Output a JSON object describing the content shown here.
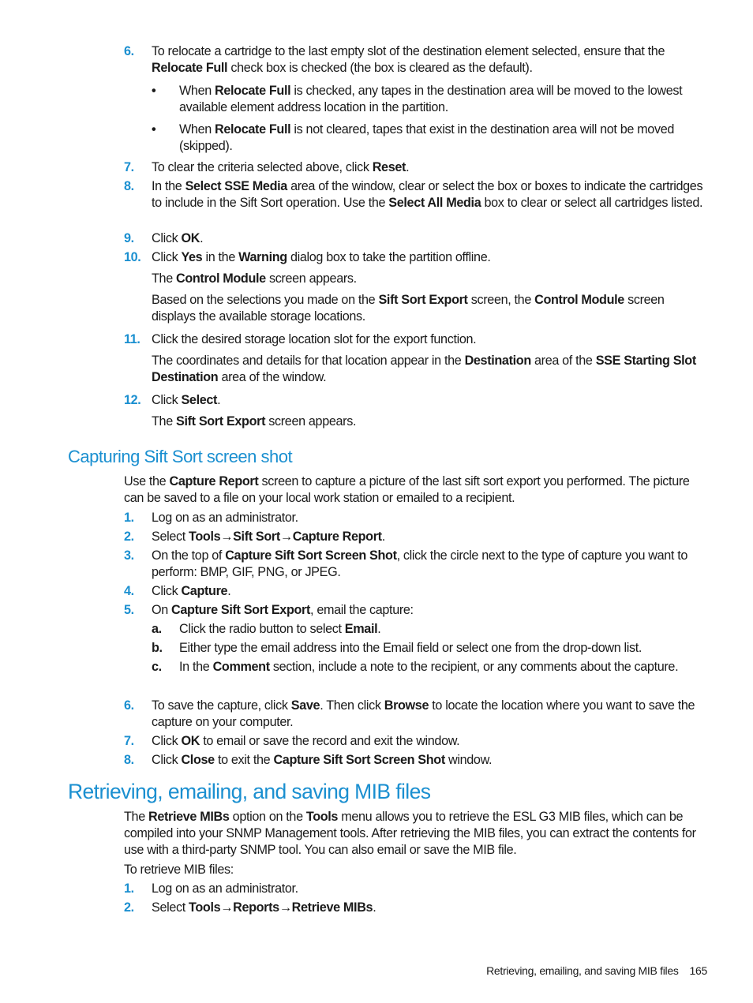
{
  "section1": {
    "step6": {
      "num": "6.",
      "t1": "To relocate a cartridge to the last empty slot of the destination element selected, ensure that the ",
      "b1": "Relocate Full",
      "t2": " check box is checked (the box is cleared as the default).",
      "bullets": [
        {
          "t1": "When ",
          "b1": "Relocate Full",
          "t2": " is checked, any tapes in the destination area will be moved to the lowest available element address location in the partition."
        },
        {
          "t1": "When ",
          "b1": "Relocate Full",
          "t2": " is not cleared, tapes that exist in the destination area will not be moved (skipped)."
        }
      ]
    },
    "step7": {
      "num": "7.",
      "t1": "To clear the criteria selected above, click ",
      "b1": "Reset",
      "t2": "."
    },
    "step8": {
      "num": "8.",
      "t1": "In the ",
      "b1": "Select SSE Media",
      "t2": " area of the window, clear or select the box or boxes to indicate the cartridges to include in the Sift Sort operation. Use the ",
      "b2": "Select All Media",
      "t3": " box to clear or select all cartridges listed."
    },
    "step9": {
      "num": "9.",
      "t1": "Click ",
      "b1": "OK",
      "t2": "."
    },
    "step10": {
      "num": "10.",
      "t1": "Click ",
      "b1": "Yes",
      "t2": " in the ",
      "b2": "Warning",
      "t3": " dialog box to take the partition offline.",
      "note1": {
        "t1": "The ",
        "b1": "Control Module",
        "t2": " screen appears."
      },
      "note2": {
        "t1": "Based on the selections you made on the ",
        "b1": "Sift Sort Export",
        "t2": " screen, the ",
        "b2": "Control Module",
        "t3": " screen displays the available storage locations."
      }
    },
    "step11": {
      "num": "11.",
      "t1": "Click the desired storage location slot for the export function.",
      "note1": {
        "t1": "The coordinates and details for that location appear in the ",
        "b1": "Destination",
        "t2": " area of the ",
        "b2": "SSE Starting Slot Destination",
        "t3": " area of the window."
      }
    },
    "step12": {
      "num": "12.",
      "t1": "Click ",
      "b1": "Select",
      "t2": ".",
      "note1": {
        "t1": "The ",
        "b1": "Sift Sort Export",
        "t2": " screen appears."
      }
    }
  },
  "section2": {
    "heading": "Capturing Sift Sort screen shot",
    "intro": {
      "t1": "Use the ",
      "b1": "Capture Report",
      "t2": " screen to capture a picture of the last sift sort export you performed. The picture can be saved to a file on your local work station or emailed to a recipient."
    },
    "step1": {
      "num": "1.",
      "t1": "Log on as an administrator."
    },
    "step2": {
      "num": "2.",
      "t1": "Select ",
      "b1": "Tools",
      "arrow": "→",
      "b2": "Sift Sort",
      "b3": "Capture Report",
      "t2": "."
    },
    "step3": {
      "num": "3.",
      "t1": "On the top of ",
      "b1": "Capture Sift Sort Screen Shot",
      "t2": ", click the circle next to the type of capture you want to perform: BMP, GIF, PNG, or JPEG."
    },
    "step4": {
      "num": "4.",
      "t1": "Click ",
      "b1": "Capture",
      "t2": "."
    },
    "step5": {
      "num": "5.",
      "t1": "On ",
      "b1": "Capture Sift Sort Export",
      "t2": ", email the capture:",
      "subs": [
        {
          "lbl": "a.",
          "t1": "Click the radio button to select ",
          "b1": "Email",
          "t2": "."
        },
        {
          "lbl": "b.",
          "t1": "Either type the email address into the Email field or select one from the drop-down list.",
          "b1": "",
          "t2": ""
        },
        {
          "lbl": "c.",
          "t1": "In the ",
          "b1": "Comment",
          "t2": " section, include a note to the recipient, or any comments about the capture."
        }
      ]
    },
    "step6": {
      "num": "6.",
      "t1": "To save the capture, click ",
      "b1": "Save",
      "t2": ". Then click ",
      "b2": "Browse",
      "t3": " to locate the location where you want to save the capture on your computer."
    },
    "step7": {
      "num": "7.",
      "t1": "Click ",
      "b1": "OK",
      "t2": " to email or save the record and exit the window."
    },
    "step8": {
      "num": "8.",
      "t1": "Click ",
      "b1": "Close",
      "t2": " to exit the ",
      "b2": "Capture Sift Sort Screen Shot",
      "t3": " window."
    }
  },
  "section3": {
    "heading": "Retrieving, emailing, and saving MIB files",
    "intro": {
      "t1": "The ",
      "b1": "Retrieve MIBs",
      "t2": " option on the ",
      "b2": "Tools",
      "t3": " menu allows you to retrieve the ESL G3 MIB files, which can be compiled into your SNMP Management tools. After retrieving the MIB files, you can extract the contents for use with a third-party SNMP tool. You can also email or save the MIB file."
    },
    "lead": "To retrieve MIB files:",
    "step1": {
      "num": "1.",
      "t1": "Log on as an administrator."
    },
    "step2": {
      "num": "2.",
      "t1": "Select ",
      "b1": "Tools",
      "arrow": "→",
      "b2": "Reports",
      "b3": "Retrieve MIBs",
      "t2": "."
    }
  },
  "footer": {
    "section_title": "Retrieving, emailing, and saving MIB files",
    "page_number": "165"
  }
}
